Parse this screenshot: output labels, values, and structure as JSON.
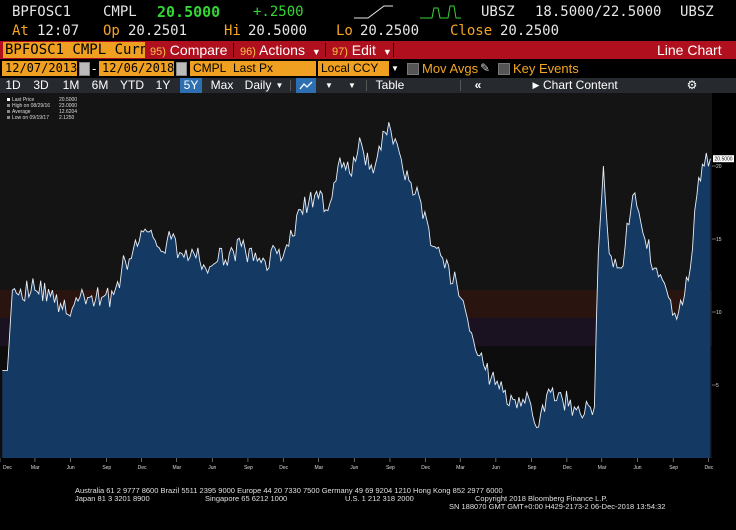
{
  "quote": {
    "ticker": "BPFOSC1",
    "source": "CMPL",
    "last": "20.5000",
    "change": "+.2500",
    "bid_source": "UBSZ",
    "bid": "18.5000",
    "ask": "/22.5000",
    "ask_source": "UBSZ",
    "at_label": "At",
    "time": "12:07",
    "open_label": "Op",
    "open": "20.2501",
    "high_label": "Hi",
    "high": "20.5000",
    "low_label": "Lo",
    "low": "20.2500",
    "close_label": "Close",
    "close": "20.2500"
  },
  "titlebar": {
    "ticker_field": "BPFOSC1 CMPL Curn",
    "compare_num": "95)",
    "compare_label": "Compare",
    "actions_num": "96)",
    "actions_label": "Actions",
    "edit_num": "97)",
    "edit_label": "Edit",
    "chart_type": "Line Chart"
  },
  "settings": {
    "start_date": "12/07/2013",
    "end_date": "12/06/2018",
    "source": "CMPL",
    "field": "Last Px",
    "currency": "Local CCY",
    "mov_avgs_label": "Mov Avgs",
    "key_events_label": "Key Events"
  },
  "toolbar": {
    "ranges": [
      "1D",
      "3D",
      "1M",
      "6M",
      "YTD",
      "1Y",
      "5Y",
      "Max"
    ],
    "selected_range": "5Y",
    "frequency": "Daily",
    "table_label": "Table",
    "chart_content_label": "Chart Content"
  },
  "colors": {
    "accent_orange": "#f5a623",
    "title_bar_red": "#b0101e",
    "field_orange": "#f0a020",
    "positive_green": "#33d633",
    "area_fill": "#143a64",
    "line": "#e8eef5",
    "selected_tab": "#2d6fb0"
  },
  "legend": [
    {
      "label": "Last Price",
      "value": "20.5000"
    },
    {
      "label": "High on 08/29/16",
      "value": "23.0000"
    },
    {
      "label": "Average",
      "value": "12.6204"
    },
    {
      "label": "Low on 09/19/17",
      "value": "2.1250"
    }
  ],
  "chart_data": {
    "type": "area",
    "series": [
      {
        "name": "Last Price",
        "x": [
          "2013-12-07",
          "2013-12-20",
          "2014-01-02",
          "2014-03-01",
          "2014-04-15",
          "2014-05-01",
          "2014-06-10",
          "2014-07-15",
          "2014-08-20",
          "2014-09-20",
          "2014-10-20",
          "2014-11-20",
          "2014-12-15",
          "2015-01-10",
          "2015-02-15",
          "2015-03-15",
          "2015-04-15",
          "2015-05-15",
          "2015-06-15",
          "2015-07-15",
          "2015-08-15",
          "2015-09-15",
          "2015-10-15",
          "2015-11-15",
          "2015-12-15",
          "2016-01-15",
          "2016-02-20",
          "2016-03-20",
          "2016-04-20",
          "2016-05-20",
          "2016-06-20",
          "2016-07-20",
          "2016-08-29",
          "2016-09-20",
          "2016-10-20",
          "2016-11-20",
          "2016-12-20",
          "2017-01-20",
          "2017-02-20",
          "2017-03-20",
          "2017-04-20",
          "2017-05-20",
          "2017-06-20",
          "2017-07-20",
          "2017-08-20",
          "2017-09-19",
          "2017-10-20",
          "2017-11-20",
          "2017-12-20",
          "2018-01-15",
          "2018-02-10",
          "2018-02-20",
          "2018-03-05",
          "2018-03-20",
          "2018-04-20",
          "2018-05-20",
          "2018-06-20",
          "2018-07-20",
          "2018-08-20",
          "2018-09-10",
          "2018-09-25",
          "2018-10-15",
          "2018-11-01",
          "2018-11-20",
          "2018-12-06"
        ],
        "values": [
          6.0,
          6.0,
          11.5,
          11.5,
          11.5,
          10.0,
          10.5,
          11.0,
          11.0,
          11.2,
          13.5,
          14.5,
          15.5,
          14.5,
          15.0,
          14.0,
          14.0,
          13.0,
          13.5,
          14.0,
          14.5,
          13.5,
          13.5,
          14.0,
          14.5,
          17.0,
          18.0,
          17.0,
          20.0,
          19.5,
          21.5,
          19.5,
          23.0,
          21.5,
          19.0,
          17.5,
          14.5,
          13.0,
          12.0,
          9.5,
          7.0,
          5.5,
          4.5,
          4.0,
          4.5,
          2.125,
          4.5,
          4.0,
          3.5,
          3.0,
          3.5,
          14.0,
          20.0,
          14.0,
          13.0,
          18.0,
          15.0,
          13.0,
          11.0,
          9.5,
          10.5,
          13.0,
          18.0,
          20.0,
          20.5
        ]
      }
    ],
    "last_value_label": "20.5000",
    "ylim": [
      0,
      25
    ],
    "y_ticks": [
      5,
      10,
      15,
      20
    ],
    "x_tick_labels": [
      "Dec",
      "Mar",
      "Jun",
      "Sep",
      "Dec",
      "Mar",
      "Jun",
      "Sep",
      "Dec",
      "Mar",
      "Jun",
      "Sep",
      "Dec",
      "Mar",
      "Jun",
      "Sep",
      "Dec",
      "Mar",
      "Jun",
      "Sep",
      "Dec"
    ],
    "year_labels": [
      "2014",
      "2015",
      "2016",
      "2017",
      "2018"
    ],
    "grid": false,
    "legend_position": "top-left"
  },
  "footer": {
    "line1": "Australia 61 2 9777 8600 Brazil 5511 2395 9000 Europe 44 20 7330 7500 Germany 49 69 9204 1210 Hong Kong 852 2977 6000",
    "line2a": "Japan 81 3 3201 8900",
    "line2b": "Singapore 65 6212 1000",
    "line2c": "U.S. 1 212 318 2000",
    "line2d": "Copyright 2018 Bloomberg Finance L.P.",
    "line3": "SN 188070 GMT  GMT+0:00 H429-2173-2 06-Dec-2018 13:54:32"
  }
}
